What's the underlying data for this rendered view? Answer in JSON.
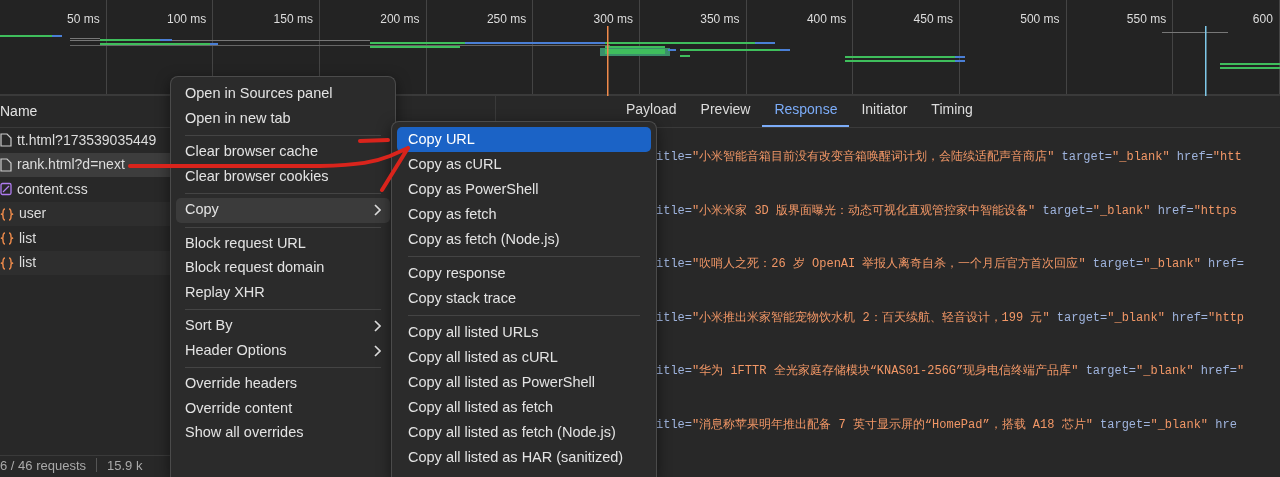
{
  "timeline": {
    "ticks": [
      "50 ms",
      "100 ms",
      "150 ms",
      "200 ms",
      "250 ms",
      "300 ms",
      "350 ms",
      "400 ms",
      "450 ms",
      "500 ms",
      "550 ms",
      "600"
    ]
  },
  "request_list": {
    "column": "Name",
    "rows": [
      {
        "name": "tt.html?173539035449",
        "kind": "document",
        "selected": false
      },
      {
        "name": "rank.html?d=next",
        "kind": "document",
        "selected": true
      },
      {
        "name": "content.css",
        "kind": "stylesheet",
        "selected": false
      },
      {
        "name": "user",
        "kind": "fetch",
        "selected": false
      },
      {
        "name": "list",
        "kind": "fetch",
        "selected": false
      },
      {
        "name": "list",
        "kind": "fetch",
        "selected": false
      }
    ]
  },
  "status_bar": {
    "requests": "6 / 46 requests",
    "transferred": "15.9 k"
  },
  "detail_tabs": [
    {
      "label": "Payload",
      "selected": false
    },
    {
      "label": "Preview",
      "selected": false
    },
    {
      "label": "Response",
      "selected": true
    },
    {
      "label": "Initiator",
      "selected": false
    },
    {
      "label": "Timing",
      "selected": false
    }
  ],
  "response_lines": [
    [
      {
        "kind": "attr",
        "text": "itle="
      },
      {
        "kind": "string",
        "text": "\"小米智能音箱目前没有改变音箱唤醒词计划，会陆续适配声音商店\""
      },
      {
        "kind": "attr",
        "text": " target="
      },
      {
        "kind": "string",
        "text": "\"_blank\""
      },
      {
        "kind": "attr",
        "text": " href="
      },
      {
        "kind": "string",
        "text": "\"htt"
      }
    ],
    [
      {
        "kind": "attr",
        "text": "itle="
      },
      {
        "kind": "string",
        "text": "\"小米米家 3D 版界面曝光：动态可视化直观管控家中智能设备\""
      },
      {
        "kind": "attr",
        "text": " target="
      },
      {
        "kind": "string",
        "text": "\"_blank\""
      },
      {
        "kind": "attr",
        "text": " href="
      },
      {
        "kind": "string",
        "text": "\"https"
      }
    ],
    [
      {
        "kind": "attr",
        "text": "itle="
      },
      {
        "kind": "string",
        "text": "\"吹哨人之死：26 岁 OpenAI 举报人离奇自杀，一个月后官方首次回应\""
      },
      {
        "kind": "attr",
        "text": " target="
      },
      {
        "kind": "string",
        "text": "\"_blank\""
      },
      {
        "kind": "attr",
        "text": " href="
      }
    ],
    [
      {
        "kind": "attr",
        "text": "itle="
      },
      {
        "kind": "string",
        "text": "\"小米推出米家智能宠物饮水机 2：百天续航、轻音设计，199 元\""
      },
      {
        "kind": "attr",
        "text": " target="
      },
      {
        "kind": "string",
        "text": "\"_blank\""
      },
      {
        "kind": "attr",
        "text": " href="
      },
      {
        "kind": "string",
        "text": "\"http"
      }
    ],
    [
      {
        "kind": "attr",
        "text": "itle="
      },
      {
        "kind": "string",
        "text": "\"华为 iFTTR 全光家庭存储模块“KNAS01-256G”现身电信终端产品库\""
      },
      {
        "kind": "attr",
        "text": " target="
      },
      {
        "kind": "string",
        "text": "\"_blank\""
      },
      {
        "kind": "attr",
        "text": " href="
      },
      {
        "kind": "string",
        "text": "\""
      }
    ],
    [
      {
        "kind": "attr",
        "text": "itle="
      },
      {
        "kind": "string",
        "text": "\"消息称苹果明年推出配备 7 英寸显示屏的“HomePad”，搭载 A18 芯片\""
      },
      {
        "kind": "attr",
        "text": " target="
      },
      {
        "kind": "string",
        "text": "\"_blank\""
      },
      {
        "kind": "attr",
        "text": " hre"
      }
    ]
  ],
  "context_menu": {
    "groups": [
      [
        {
          "label": "Open in Sources panel",
          "submenu": false,
          "selected": false
        },
        {
          "label": "Open in new tab",
          "submenu": false,
          "selected": false
        }
      ],
      [
        {
          "label": "Clear browser cache",
          "submenu": false,
          "selected": false
        },
        {
          "label": "Clear browser cookies",
          "submenu": false,
          "selected": false
        }
      ],
      [
        {
          "label": "Copy",
          "submenu": true,
          "selected": true
        }
      ],
      [
        {
          "label": "Block request URL",
          "submenu": false,
          "selected": false
        },
        {
          "label": "Block request domain",
          "submenu": false,
          "selected": false
        },
        {
          "label": "Replay XHR",
          "submenu": false,
          "selected": false
        }
      ],
      [
        {
          "label": "Sort By",
          "submenu": true,
          "selected": false
        },
        {
          "label": "Header Options",
          "submenu": true,
          "selected": false
        }
      ],
      [
        {
          "label": "Override headers",
          "submenu": false,
          "selected": false
        },
        {
          "label": "Override content",
          "submenu": false,
          "selected": false
        },
        {
          "label": "Show all overrides",
          "submenu": false,
          "selected": false
        }
      ]
    ]
  },
  "copy_submenu": {
    "groups": [
      [
        {
          "label": "Copy URL",
          "selected": true
        },
        {
          "label": "Copy as cURL",
          "selected": false
        },
        {
          "label": "Copy as PowerShell",
          "selected": false
        },
        {
          "label": "Copy as fetch",
          "selected": false
        },
        {
          "label": "Copy as fetch (Node.js)",
          "selected": false
        }
      ],
      [
        {
          "label": "Copy response",
          "selected": false
        },
        {
          "label": "Copy stack trace",
          "selected": false
        }
      ],
      [
        {
          "label": "Copy all listed URLs",
          "selected": false
        },
        {
          "label": "Copy all listed as cURL",
          "selected": false
        },
        {
          "label": "Copy all listed as PowerShell",
          "selected": false
        },
        {
          "label": "Copy all listed as fetch",
          "selected": false
        },
        {
          "label": "Copy all listed as fetch (Node.js)",
          "selected": false
        },
        {
          "label": "Copy all listed as HAR (sanitized)",
          "selected": false
        }
      ]
    ]
  },
  "annotation": {
    "kind": "arrow"
  }
}
